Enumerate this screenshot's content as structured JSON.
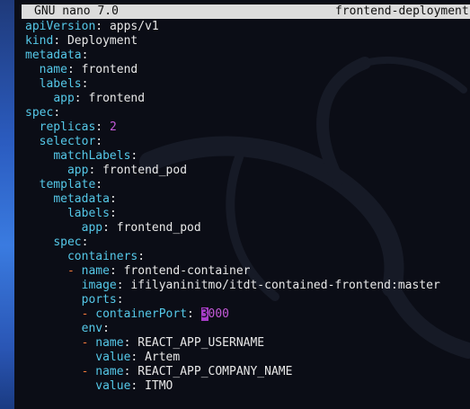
{
  "titlebar": {
    "app": "GNU nano 7.0",
    "filename": "frontend-deployment"
  },
  "editor": {
    "lines": [
      [
        {
          "t": "apiVersion",
          "c": "k"
        },
        {
          "t": ": ",
          "c": "p"
        },
        {
          "t": "apps/v1",
          "c": "v"
        }
      ],
      [
        {
          "t": "kind",
          "c": "k"
        },
        {
          "t": ": ",
          "c": "p"
        },
        {
          "t": "Deployment",
          "c": "v"
        }
      ],
      [
        {
          "t": "metadata",
          "c": "k"
        },
        {
          "t": ":",
          "c": "p"
        }
      ],
      [
        {
          "t": "  "
        },
        {
          "t": "name",
          "c": "k"
        },
        {
          "t": ": ",
          "c": "p"
        },
        {
          "t": "frontend",
          "c": "v"
        }
      ],
      [
        {
          "t": "  "
        },
        {
          "t": "labels",
          "c": "k"
        },
        {
          "t": ":",
          "c": "p"
        }
      ],
      [
        {
          "t": "    "
        },
        {
          "t": "app",
          "c": "k"
        },
        {
          "t": ": ",
          "c": "p"
        },
        {
          "t": "frontend",
          "c": "v"
        }
      ],
      [
        {
          "t": "spec",
          "c": "k"
        },
        {
          "t": ":",
          "c": "p"
        }
      ],
      [
        {
          "t": "  "
        },
        {
          "t": "replicas",
          "c": "k"
        },
        {
          "t": ": ",
          "c": "p"
        },
        {
          "t": "2",
          "c": "n"
        }
      ],
      [
        {
          "t": "  "
        },
        {
          "t": "selector",
          "c": "k"
        },
        {
          "t": ":",
          "c": "p"
        }
      ],
      [
        {
          "t": "    "
        },
        {
          "t": "matchLabels",
          "c": "k"
        },
        {
          "t": ":",
          "c": "p"
        }
      ],
      [
        {
          "t": "      "
        },
        {
          "t": "app",
          "c": "k"
        },
        {
          "t": ": ",
          "c": "p"
        },
        {
          "t": "frontend_pod",
          "c": "v"
        }
      ],
      [
        {
          "t": "  "
        },
        {
          "t": "template",
          "c": "k"
        },
        {
          "t": ":",
          "c": "p"
        }
      ],
      [
        {
          "t": "    "
        },
        {
          "t": "metadata",
          "c": "k"
        },
        {
          "t": ":",
          "c": "p"
        }
      ],
      [
        {
          "t": "      "
        },
        {
          "t": "labels",
          "c": "k"
        },
        {
          "t": ":",
          "c": "p"
        }
      ],
      [
        {
          "t": "        "
        },
        {
          "t": "app",
          "c": "k"
        },
        {
          "t": ": ",
          "c": "p"
        },
        {
          "t": "frontend_pod",
          "c": "v"
        }
      ],
      [
        {
          "t": "    "
        },
        {
          "t": "spec",
          "c": "k"
        },
        {
          "t": ":",
          "c": "p"
        }
      ],
      [
        {
          "t": "      "
        },
        {
          "t": "containers",
          "c": "k"
        },
        {
          "t": ":",
          "c": "p"
        }
      ],
      [
        {
          "t": "      "
        },
        {
          "t": "-",
          "c": "d"
        },
        {
          "t": " "
        },
        {
          "t": "name",
          "c": "k"
        },
        {
          "t": ": ",
          "c": "p"
        },
        {
          "t": "frontend-container",
          "c": "v"
        }
      ],
      [
        {
          "t": "        "
        },
        {
          "t": "image",
          "c": "k"
        },
        {
          "t": ": ",
          "c": "p"
        },
        {
          "t": "ifilyaninitmo/itdt-contained-frontend:master",
          "c": "v"
        }
      ],
      [
        {
          "t": "        "
        },
        {
          "t": "ports",
          "c": "k"
        },
        {
          "t": ":",
          "c": "p"
        }
      ],
      [
        {
          "t": "        "
        },
        {
          "t": "-",
          "c": "d"
        },
        {
          "t": " "
        },
        {
          "t": "containerPort",
          "c": "k"
        },
        {
          "t": ": ",
          "c": "p"
        },
        {
          "t": "3",
          "c": "cur"
        },
        {
          "t": "000",
          "c": "n"
        }
      ],
      [
        {
          "t": "        "
        },
        {
          "t": "env",
          "c": "k"
        },
        {
          "t": ":",
          "c": "p"
        }
      ],
      [
        {
          "t": "        "
        },
        {
          "t": "-",
          "c": "d"
        },
        {
          "t": " "
        },
        {
          "t": "name",
          "c": "k"
        },
        {
          "t": ": ",
          "c": "p"
        },
        {
          "t": "REACT_APP_USERNAME",
          "c": "v"
        }
      ],
      [
        {
          "t": "          "
        },
        {
          "t": "value",
          "c": "k"
        },
        {
          "t": ": ",
          "c": "p"
        },
        {
          "t": "Artem",
          "c": "v"
        }
      ],
      [
        {
          "t": "        "
        },
        {
          "t": "-",
          "c": "d"
        },
        {
          "t": " "
        },
        {
          "t": "name",
          "c": "k"
        },
        {
          "t": ": ",
          "c": "p"
        },
        {
          "t": "REACT_APP_COMPANY_NAME",
          "c": "v"
        }
      ],
      [
        {
          "t": "          "
        },
        {
          "t": "value",
          "c": "k"
        },
        {
          "t": ": ",
          "c": "p"
        },
        {
          "t": "ITMO",
          "c": "v"
        }
      ]
    ]
  },
  "colors": {
    "key": "#55c8e8",
    "number": "#c45ad8",
    "dash": "#f07a3a",
    "cursor": "#a83dc8",
    "background": "#0b0d16",
    "titlebar": "#dcdcdc"
  }
}
